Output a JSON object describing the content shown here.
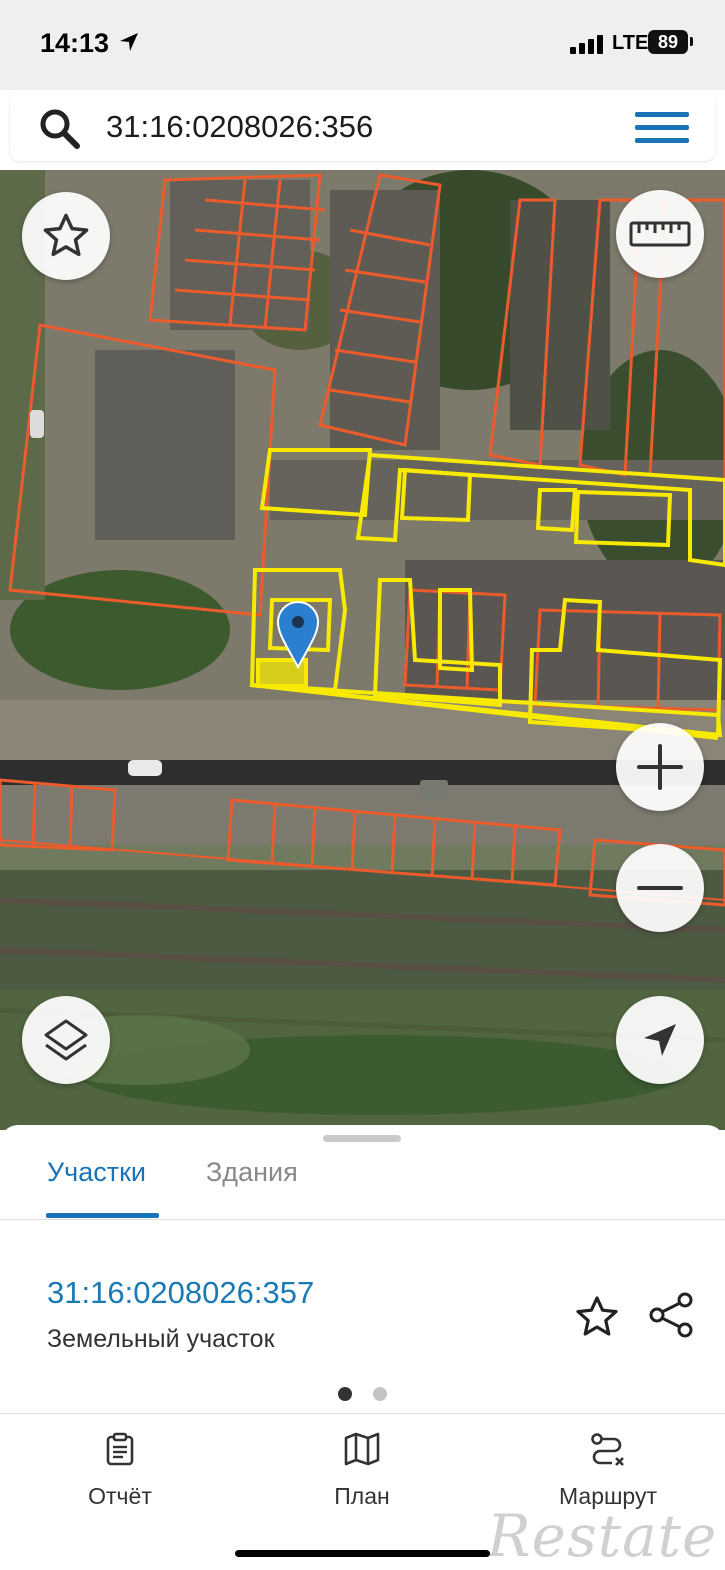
{
  "status_bar": {
    "time": "14:13",
    "network": "LTE",
    "battery": "89"
  },
  "search": {
    "query": "31:16:0208026:356"
  },
  "map": {
    "buttons": [
      "favorite",
      "ruler",
      "zoom-in",
      "zoom-out",
      "layers",
      "my-location"
    ],
    "colors": {
      "parcel_outline": "#ec5b2c",
      "selected_outline": "#f7ea00",
      "marker": "#2a7fd0"
    }
  },
  "sheet": {
    "tabs": [
      {
        "label": "Участки",
        "active": true
      },
      {
        "label": "Здания",
        "active": false
      }
    ],
    "parcel": {
      "number": "31:16:0208026:357",
      "type": "Земельный участок"
    },
    "page_indicator": {
      "current": 1,
      "total": 2
    }
  },
  "bottom_nav": {
    "items": [
      {
        "label": "Отчёт",
        "icon": "report-icon"
      },
      {
        "label": "План",
        "icon": "map-icon"
      },
      {
        "label": "Маршрут",
        "icon": "route-icon"
      }
    ]
  },
  "watermark": "Restate",
  "accent_color": "#1a73b7"
}
